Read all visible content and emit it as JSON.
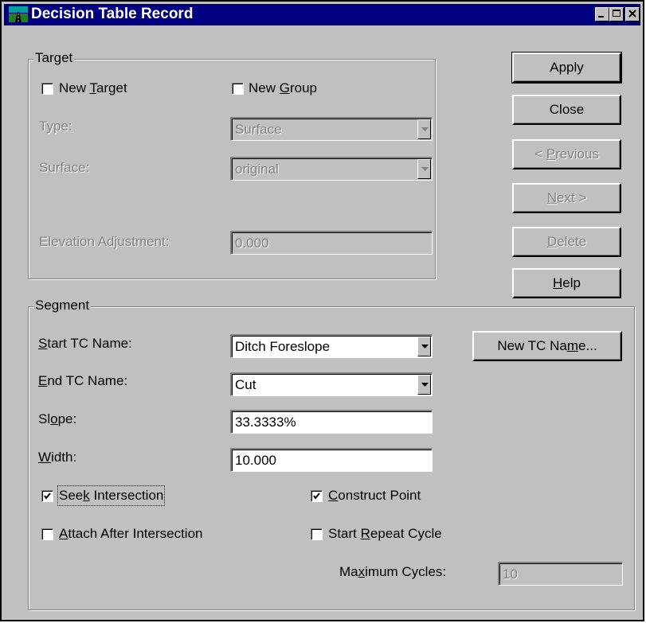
{
  "window": {
    "title": "Decision Table Record",
    "controls": {
      "minimize": "minimize",
      "maximize": "maximize",
      "close": "close"
    }
  },
  "target": {
    "legend": "Target",
    "new_target": {
      "pre": "New ",
      "key": "T",
      "post": "arget",
      "checked": false
    },
    "new_group": {
      "pre": "New ",
      "key": "G",
      "post": "roup",
      "checked": false
    },
    "type_label": "Type:",
    "type_value": "Surface",
    "surface_label": "Surface:",
    "surface_value": "original",
    "elev_label": "Elevation Adjustment:",
    "elev_value": "0.000"
  },
  "buttons": {
    "apply": "Apply",
    "close": "Close",
    "previous": {
      "pre": "< ",
      "key": "P",
      "post": "revious"
    },
    "next": {
      "key": "N",
      "post": "ext >"
    },
    "delete": {
      "key": "D",
      "post": "elete"
    },
    "help": {
      "key": "H",
      "post": "elp"
    }
  },
  "segment": {
    "legend": "Segment",
    "start_tc_label": {
      "key": "S",
      "post": "tart TC Name:"
    },
    "start_tc_value": "Ditch Foreslope",
    "end_tc_label": {
      "key": "E",
      "post": "nd TC Name:"
    },
    "end_tc_value": "Cut",
    "slope_label": {
      "pre": "Sl",
      "key": "o",
      "post": "pe:"
    },
    "slope_value": "33.3333%",
    "width_label": {
      "key": "W",
      "post": "idth:"
    },
    "width_value": "10.000",
    "new_tc_button": {
      "pre": "New TC Na",
      "key": "m",
      "post": "e..."
    },
    "seek_intersection": {
      "pre": "See",
      "key": "k",
      "post": " Intersection",
      "checked": true
    },
    "construct_point": {
      "key": "C",
      "post": "onstruct Point",
      "checked": true
    },
    "attach_after": {
      "key": "A",
      "post": "ttach After Intersection",
      "checked": false
    },
    "start_repeat": {
      "pre": "Start ",
      "key": "R",
      "post": "epeat Cycle",
      "checked": false
    },
    "max_cycles_label": {
      "pre": "Ma",
      "key": "x",
      "post": "imum Cycles:"
    },
    "max_cycles_value": "10"
  }
}
